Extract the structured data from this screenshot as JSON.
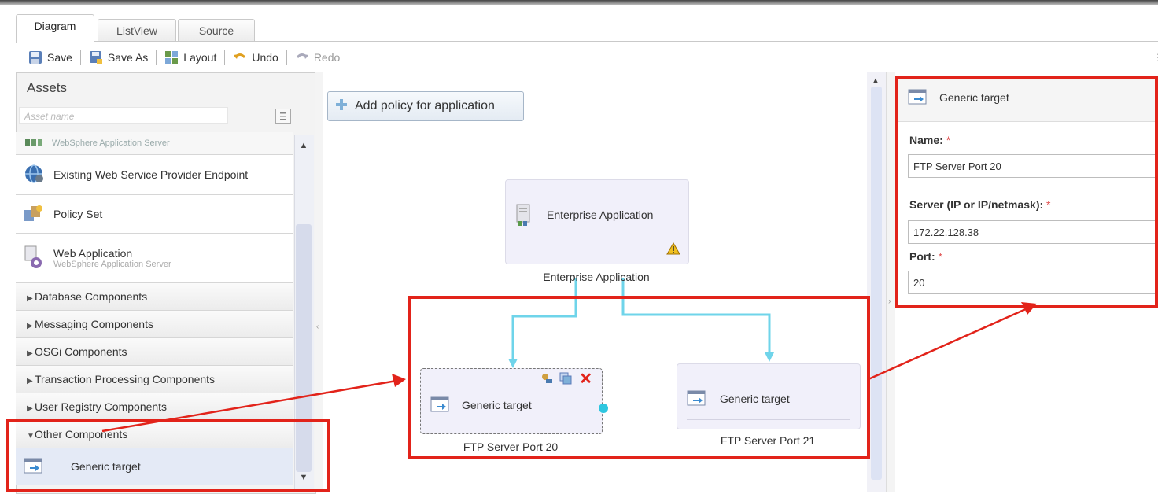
{
  "tabs": [
    {
      "label": "Diagram",
      "active": true
    },
    {
      "label": "ListView",
      "active": false
    },
    {
      "label": "Source",
      "active": false
    }
  ],
  "toolbar": {
    "save": "Save",
    "save_as": "Save As",
    "layout": "Layout",
    "undo": "Undo",
    "redo": "Redo"
  },
  "assets": {
    "title": "Assets",
    "search_placeholder": "Asset name",
    "items": [
      {
        "label": "WebSphere Application Server",
        "icon": "server-icon"
      },
      {
        "label": "Existing Web Service Provider Endpoint",
        "icon": "globe-icon"
      },
      {
        "label": "Policy Set",
        "icon": "policy-icon"
      },
      {
        "label": "Web Application",
        "sublabel": "WebSphere Application Server",
        "icon": "web-app-icon"
      }
    ],
    "categories": [
      {
        "label": "Database Components",
        "expanded": false
      },
      {
        "label": "Messaging Components",
        "expanded": false
      },
      {
        "label": "OSGi Components",
        "expanded": false
      },
      {
        "label": "Transaction Processing Components",
        "expanded": false
      },
      {
        "label": "User Registry Components",
        "expanded": false
      },
      {
        "label": "Other Components",
        "expanded": true
      }
    ],
    "other_items": [
      {
        "label": "Generic target",
        "icon": "generic-target-icon"
      }
    ]
  },
  "canvas": {
    "add_policy_label": "Add policy for application",
    "nodes": {
      "enterprise": {
        "title": "Enterprise Application",
        "caption": "Enterprise Application",
        "warning": true
      },
      "target20": {
        "title": "Generic target",
        "caption": "FTP Server Port 20"
      },
      "target21": {
        "title": "Generic target",
        "caption": "FTP Server Port 21"
      }
    }
  },
  "properties": {
    "header": "Generic target",
    "fields": [
      {
        "label": "Name:",
        "value": "FTP Server Port 20"
      },
      {
        "label": "Server (IP or IP/netmask):",
        "value": "172.22.128.38"
      },
      {
        "label": "Port:",
        "value": "20"
      }
    ]
  },
  "colors": {
    "highlight": "#e2231a",
    "connector": "#6fd4ea",
    "node_bg": "#f1f0fa"
  }
}
